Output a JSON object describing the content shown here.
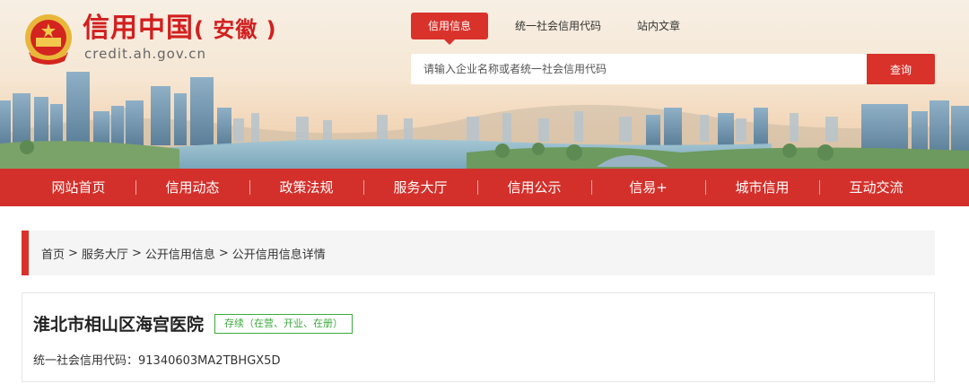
{
  "header": {
    "logo_title": "信用中国",
    "logo_province": "( 安徽 )",
    "logo_domain": "credit.ah.gov.cn",
    "emblem_icon": "national-emblem-icon"
  },
  "search": {
    "tabs": [
      {
        "label": "信用信息",
        "active": true
      },
      {
        "label": "统一社会信用代码",
        "active": false
      },
      {
        "label": "站内文章",
        "active": false
      }
    ],
    "placeholder": "请输入企业名称或者统一社会信用代码",
    "button_label": "查询"
  },
  "nav": {
    "items": [
      "网站首页",
      "信用动态",
      "政策法规",
      "服务大厅",
      "信用公示",
      "信易+",
      "城市信用",
      "互动交流"
    ]
  },
  "breadcrumb": {
    "items": [
      "首页",
      "服务大厅",
      "公开信用信息",
      "公开信用信息详情"
    ],
    "separator": ">"
  },
  "entity": {
    "name": "淮北市相山区海宫医院",
    "status": "存续（在营、开业、在册）",
    "credit_code_label": "统一社会信用代码：",
    "credit_code": "91340603MA2TBHGX5D"
  },
  "colors": {
    "brand_red": "#d9322b",
    "status_green": "#3cab3c"
  }
}
